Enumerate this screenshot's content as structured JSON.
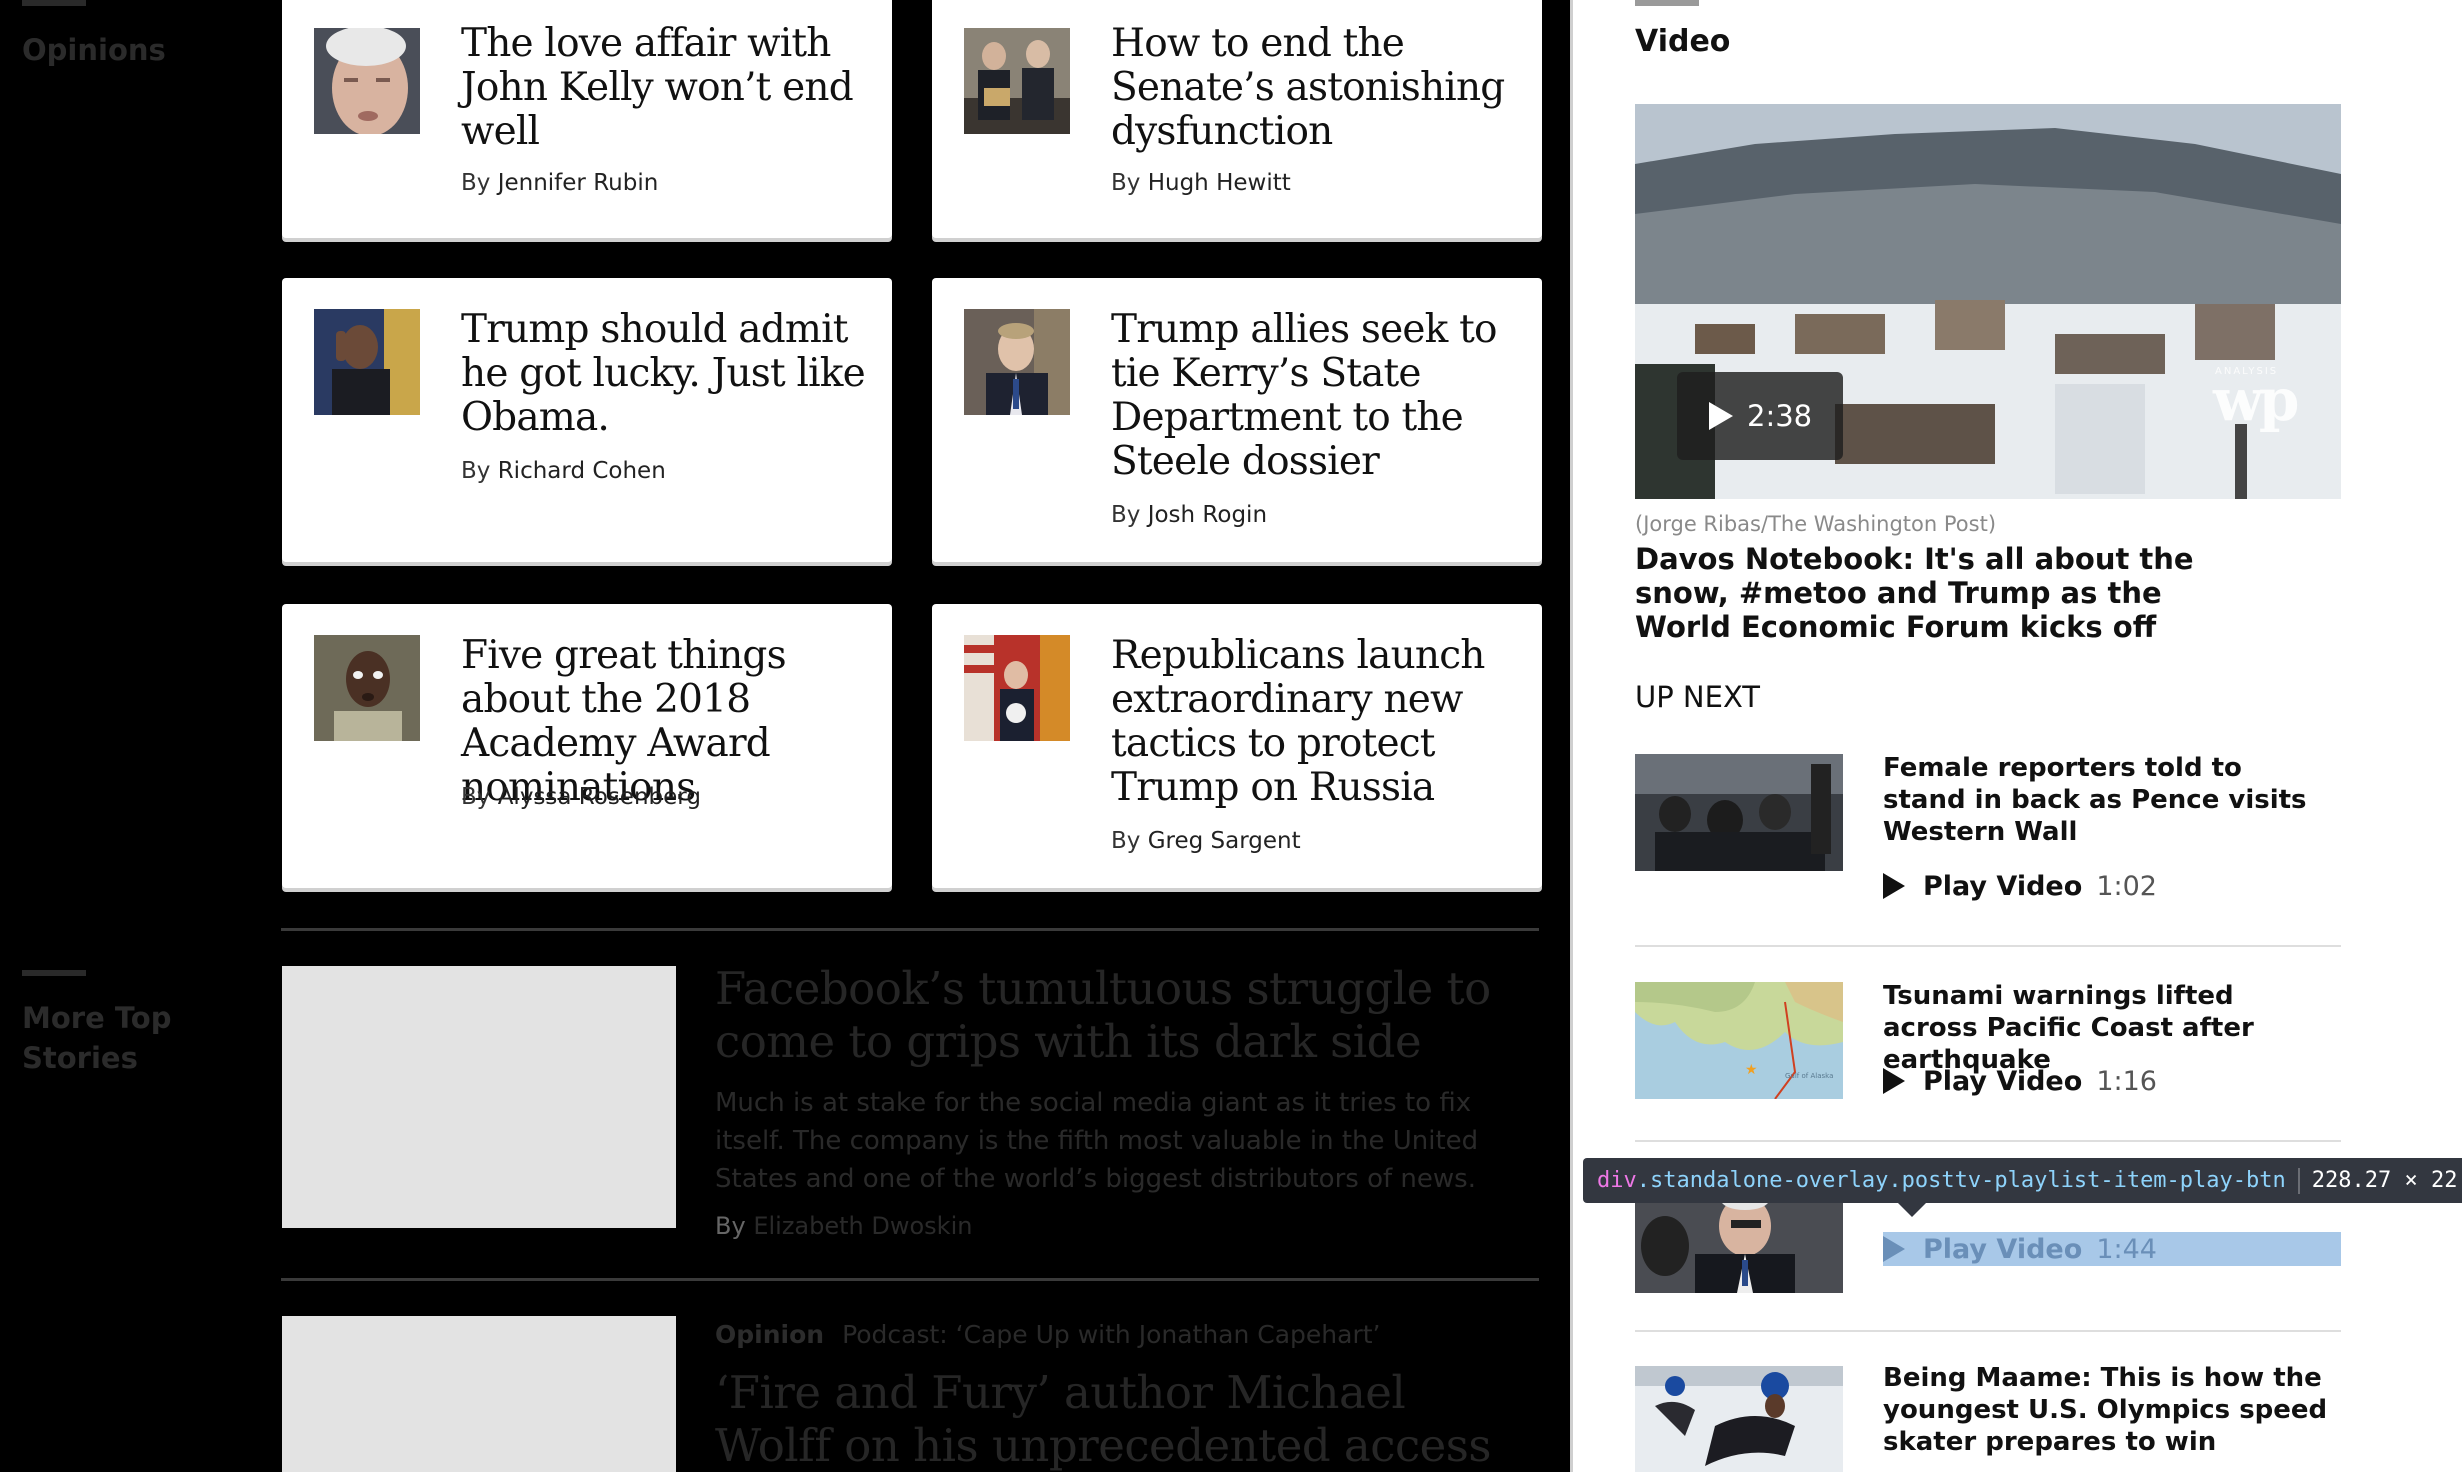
{
  "sections": {
    "opinions": "Opinions",
    "more_top_stories_line1": "More Top",
    "more_top_stories_line2": "Stories"
  },
  "opinion_cards": [
    {
      "headline": "The love affair with John Kelly won’t end well",
      "by": "By",
      "author": "Jennifer Rubin"
    },
    {
      "headline": "How to end the Senate’s astonishing dysfunction",
      "by": "By",
      "author": "Hugh Hewitt"
    },
    {
      "headline": "Trump should admit he got lucky. Just like Obama.",
      "by": "By",
      "author": "Richard Cohen"
    },
    {
      "headline": "Trump allies seek to tie Kerry’s State Department to the Steele dossier",
      "by": "By",
      "author": "Josh Rogin"
    },
    {
      "headline": "Five great things about the 2018 Academy Award nominations",
      "by": "By",
      "author": "Alyssa Rosenberg"
    },
    {
      "headline": "Republicans launch extraordinary new tactics to protect Trump on Russia",
      "by": "By",
      "author": "Greg Sargent"
    }
  ],
  "top_stories": [
    {
      "headline": "Facebook’s tumultuous struggle to come to grips with its dark side",
      "blurb": "Much is at stake for the social media giant as it tries to fix itself. The company is the fifth most valuable in the United States and one of the world’s biggest distributors of news.",
      "by": "By",
      "author": "Elizabeth Dwoskin"
    },
    {
      "kicker_label": "Opinion",
      "kicker_text": "Podcast: ‘Cape Up with Jonathan Capehart’",
      "headline": "‘Fire and Fury’ author Michael Wolff on his unprecedented access to Trump"
    }
  ],
  "video_panel": {
    "title": "Video",
    "main_video": {
      "duration": "2:38",
      "logo": "wp",
      "logo_small": "ANALYSIS",
      "credit": "(Jorge Ribas/The Washington Post)",
      "headline": "Davos Notebook: It's all about the snow, #metoo and Trump as the World Economic Forum kicks off"
    },
    "up_next_label": "UP NEXT",
    "playlist": [
      {
        "title": "Female reporters told to stand in back as Pence visits Western Wall",
        "play_label": "Play Video",
        "duration": "1:02"
      },
      {
        "title": "Tsunami warnings lifted across Pacific Coast after earthquake",
        "play_label": "Play Video",
        "duration": "1:16"
      },
      {
        "title": "",
        "play_label": "Play Video",
        "duration": "1:44"
      },
      {
        "title": "Being Maame: This is how the youngest U.S. Olympics speed skater prepares to win",
        "play_label": "",
        "duration": ""
      }
    ],
    "map_label": "Gulf of Alaska"
  },
  "devtools_tooltip": {
    "tag": "div",
    "classes": ".standalone-overlay.posttv-playlist-item-play-btn",
    "dimensions": "228.27 × 22"
  },
  "colors": {
    "page_bg": "#000000",
    "card_bg": "#ffffff",
    "highlight": "#a8c8e8",
    "tooltip_bg": "#333740"
  }
}
